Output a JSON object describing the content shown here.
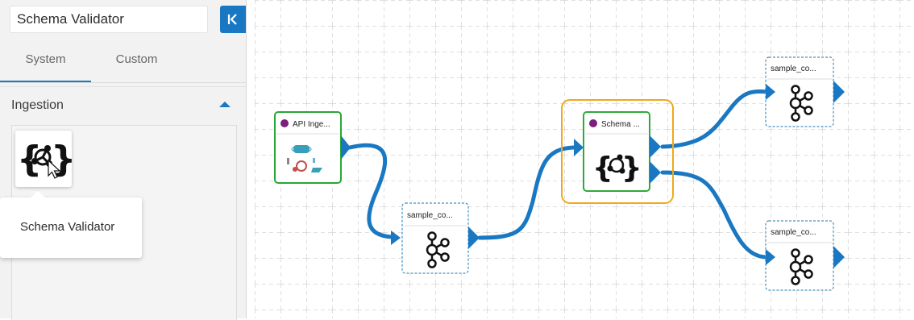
{
  "search": {
    "value": "Schema Validator"
  },
  "tabs": [
    {
      "label": "System",
      "active": true
    },
    {
      "label": "Custom",
      "active": false
    }
  ],
  "section": {
    "title": "Ingestion",
    "expanded": true
  },
  "component": {
    "icon": "schema-validator-icon",
    "tooltip": "Schema Validator"
  },
  "colors": {
    "accent": "#1a78c2",
    "node_green": "#2eaa3a",
    "selection_orange": "#f0a81c",
    "port_blue": "#1a78c2"
  },
  "pipeline": {
    "nodes": [
      {
        "id": "api-ingestion",
        "title": "API Inge...",
        "status_color": "#7a1f7a",
        "icon": "api-ingestion-icon"
      },
      {
        "id": "kafka-1",
        "title": "sample_co...",
        "icon": "kafka-icon"
      },
      {
        "id": "schema-validator",
        "title": "Schema ...",
        "status_color": "#7a1f7a",
        "icon": "schema-validator-icon",
        "selected": true
      },
      {
        "id": "kafka-2",
        "title": "sample_co...",
        "icon": "kafka-icon"
      },
      {
        "id": "kafka-3",
        "title": "sample_co...",
        "icon": "kafka-icon"
      }
    ]
  }
}
